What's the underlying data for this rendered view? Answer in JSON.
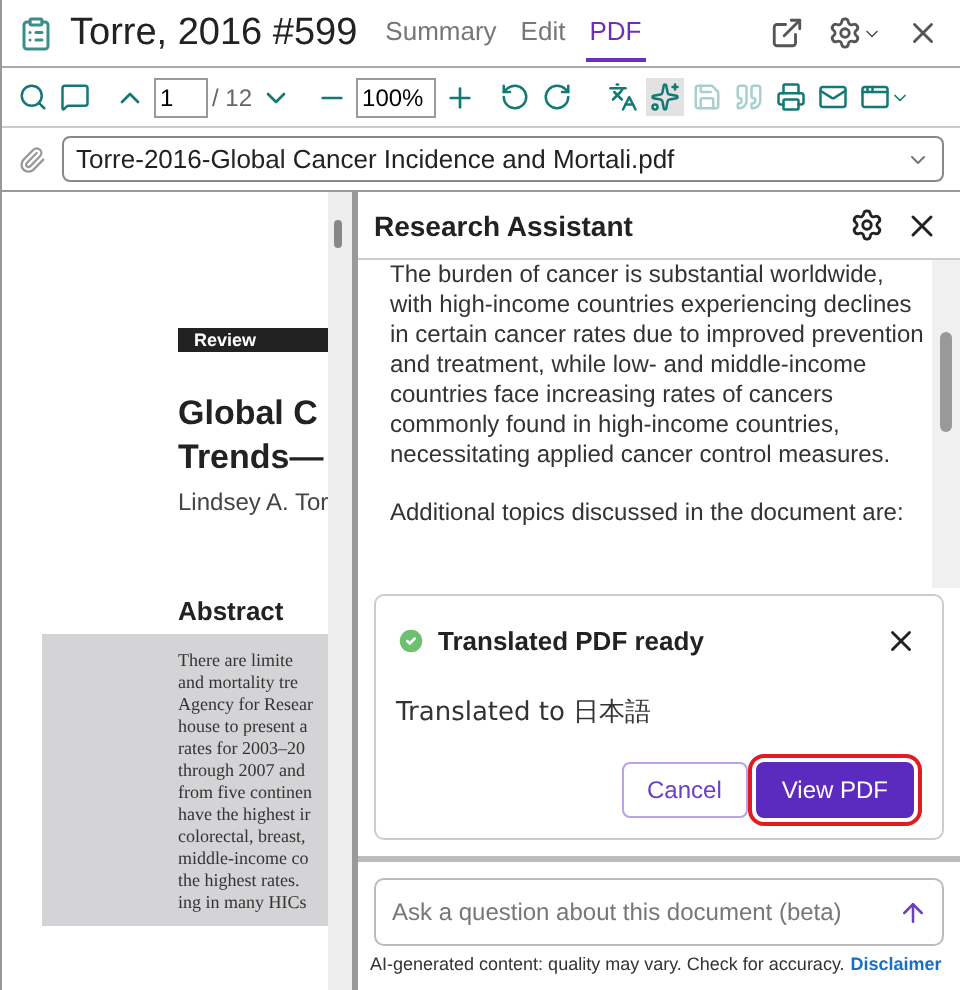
{
  "header": {
    "title": "Torre, 2016 #599",
    "tabs": [
      {
        "label": "Summary",
        "selected": false
      },
      {
        "label": "Edit",
        "selected": false
      },
      {
        "label": "PDF",
        "selected": true
      }
    ]
  },
  "toolbar": {
    "page": "1",
    "page_total": "/ 12",
    "zoom": "100%",
    "ai_selected": true
  },
  "file": {
    "name": "Torre-2016-Global Cancer Incidence and Mortali.pdf"
  },
  "document": {
    "badge": "Review",
    "title_lines": [
      "Global C",
      "Trends—"
    ],
    "authors": "Lindsey A. Tor",
    "abstract_heading": "Abstract",
    "abstract_lines": [
      "There are limite",
      "and mortality tre",
      "Agency for Resear",
      "house to present a",
      "rates for 2003–20",
      "through 2007 and",
      "from five continen",
      "have the highest ir",
      "colorectal, breast,",
      "middle-income co",
      "the highest rates.",
      "ing in many HICs"
    ]
  },
  "assistant": {
    "title": "Research Assistant",
    "paragraphs": [
      "The burden of cancer is substantial worldwide, with high-income countries experiencing declines in certain cancer rates due to improved prevention and treatment, while low- and middle-income countries face increasing rates of cancers commonly found in high-income countries, necessitating applied cancer control measures.",
      "Additional topics discussed in the document are:"
    ],
    "notice": {
      "title": "Translated PDF ready",
      "message": "Translated to 日本語",
      "buttons": [
        {
          "label": "Cancel",
          "kind": "secondary"
        },
        {
          "label": "View PDF",
          "kind": "primary",
          "highlighted": true
        }
      ]
    },
    "input": {
      "placeholder": "Ask a question about this document (beta)"
    },
    "footer": {
      "note": "AI-generated content: quality may vary. Check for accuracy.",
      "link": "Disclaimer"
    }
  }
}
